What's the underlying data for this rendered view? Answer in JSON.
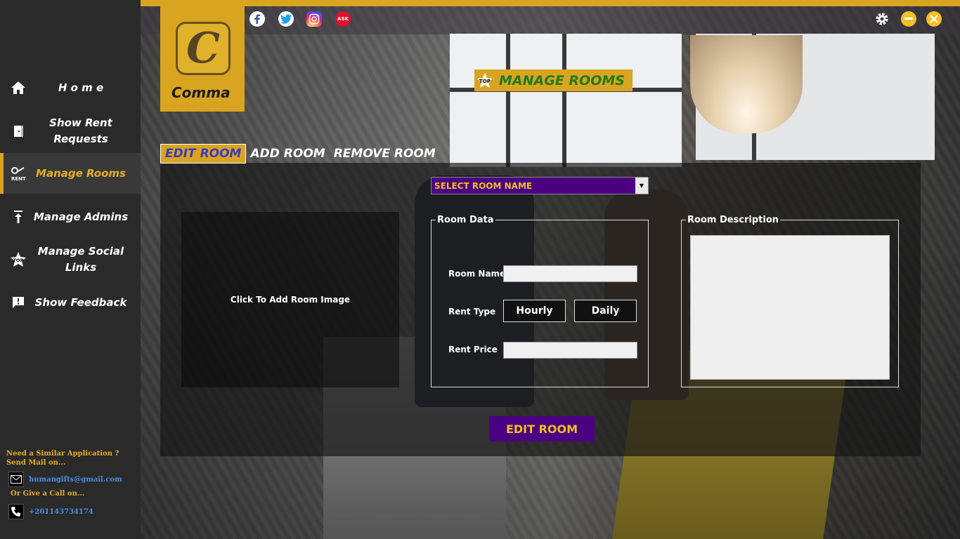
{
  "app": {
    "logo_text": "Comma",
    "logo_letter": "C"
  },
  "sidebar": {
    "items": [
      {
        "label": "H o m e",
        "icon": "home-icon",
        "active": false
      },
      {
        "label": "Show Rent Requests",
        "icon": "door-icon",
        "active": false
      },
      {
        "label": "Manage Rooms",
        "icon": "rent-key-icon",
        "active": true
      },
      {
        "label": "Manage Admins",
        "icon": "upload-arrow-icon",
        "active": false
      },
      {
        "label": "Manage Social Links",
        "icon": "top-star-icon",
        "active": false
      },
      {
        "label": "Show Feedback",
        "icon": "feedback-icon",
        "active": false
      }
    ],
    "promo": {
      "line1": "Need a Similar Application ?",
      "line2": "Send Mail on...",
      "email": "humangifts@gmail.com",
      "call_text": "Or Give a Call on...",
      "phone": "+201143734174"
    }
  },
  "header": {
    "social": [
      "facebook-icon",
      "twitter-icon",
      "instagram-icon",
      "askfm-icon"
    ],
    "askfm_label": "ASK",
    "controls": [
      "settings-icon",
      "minimize-icon",
      "close-icon"
    ]
  },
  "page": {
    "title": "MANAGE ROOMS",
    "title_badge": "TOP",
    "tabs": [
      {
        "label": "EDIT ROOM",
        "active": true
      },
      {
        "label": "ADD ROOM",
        "active": false
      },
      {
        "label": "REMOVE ROOM",
        "active": false
      }
    ]
  },
  "form": {
    "image_placeholder": "Click To Add Room Image",
    "select_room": "SELECT ROOM NAME",
    "room_data_legend": "Room Data",
    "room_name_label": "Room Name",
    "room_name_value": "",
    "rent_type_label": "Rent Type",
    "rent_type_options": [
      "Hourly",
      "Daily"
    ],
    "rent_price_label": "Rent Price",
    "rent_price_value": "",
    "description_legend": "Room Description",
    "description_value": "",
    "submit_label": "EDIT ROOM"
  },
  "colors": {
    "accent": "#d9a521",
    "purple": "#4b0082",
    "sidebar": "#2a2a2a"
  }
}
